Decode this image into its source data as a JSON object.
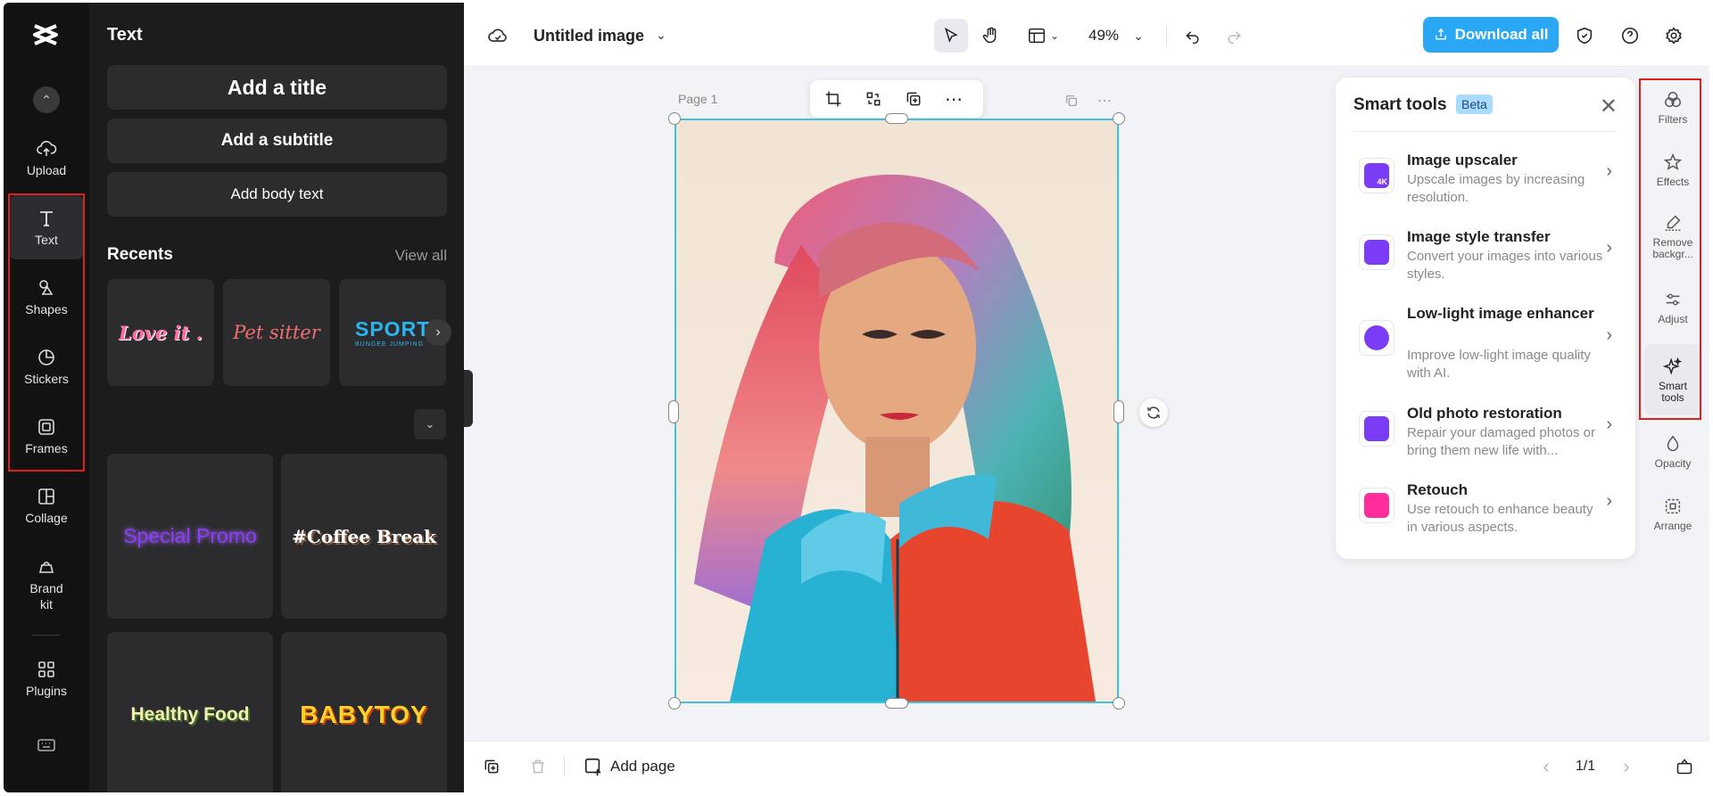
{
  "rail": {
    "items": [
      {
        "label": "Upload",
        "icon": "upload-cloud-icon"
      },
      {
        "label": "Text",
        "icon": "text-icon"
      },
      {
        "label": "Shapes",
        "icon": "shapes-icon"
      },
      {
        "label": "Stickers",
        "icon": "sticker-icon"
      },
      {
        "label": "Frames",
        "icon": "frame-icon"
      },
      {
        "label": "Collage",
        "icon": "collage-icon"
      },
      {
        "label": "Brand\nkit",
        "icon": "brand-kit-icon"
      },
      {
        "label": "Plugins",
        "icon": "plugins-icon"
      }
    ],
    "active": "Text"
  },
  "panel": {
    "title": "Text",
    "buttons": {
      "title": "Add a title",
      "subtitle": "Add a subtitle",
      "body": "Add body text"
    },
    "recents_label": "Recents",
    "view_all": "View all",
    "recents": [
      "Love it .",
      "Pet sitter",
      "SPORT",
      "BUNGEE JUMPING"
    ],
    "templates": [
      "Special Promo",
      "#Coffee Break",
      "Healthy Food",
      "BABYTOY"
    ]
  },
  "topbar": {
    "doc_title": "Untitled image",
    "zoom": "49%",
    "download": "Download all"
  },
  "canvas": {
    "page_label": "Page 1"
  },
  "bottombar": {
    "add_page": "Add page",
    "pager": "1/1"
  },
  "smart_tools": {
    "title": "Smart tools",
    "badge": "Beta",
    "items": [
      {
        "title": "Image upscaler",
        "desc": "Upscale images by increasing resolution."
      },
      {
        "title": "Image style transfer",
        "desc": "Convert your images into various styles."
      },
      {
        "title": "Low-light image enhancer",
        "desc": "Improve low-light image quality with AI."
      },
      {
        "title": "Old photo restoration",
        "desc": "Repair your damaged photos or bring them new life with..."
      },
      {
        "title": "Retouch",
        "desc": "Use retouch to enhance beauty in various aspects."
      }
    ]
  },
  "right_toolbar": {
    "items": [
      "Filters",
      "Effects",
      "Remove backgr...",
      "Adjust",
      "Smart tools",
      "Opacity",
      "Arrange"
    ],
    "active": "Smart tools"
  },
  "colors": {
    "accent": "#2aa8f5",
    "purple": "#7b3cf5",
    "highlight": "#e02020"
  }
}
